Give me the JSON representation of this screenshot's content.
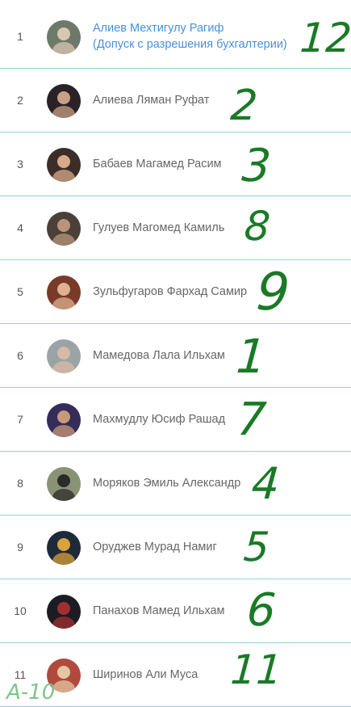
{
  "rows": [
    {
      "num": "1",
      "name": "Алиев Мехтигулу Рагиф",
      "note": "(Допуск с разрешения бухгалтерии)",
      "mark": "12",
      "colors": [
        "#6d7a6a",
        "#d9c7b0"
      ]
    },
    {
      "num": "2",
      "name": "Алиева Ляман Руфат",
      "note": "",
      "mark": "2",
      "colors": [
        "#2a2226",
        "#c8a086"
      ]
    },
    {
      "num": "3",
      "name": "Бабаев Магамед Расим",
      "note": "",
      "mark": "3",
      "colors": [
        "#3b2e29",
        "#d8a98a"
      ]
    },
    {
      "num": "4",
      "name": "Гулуев Магомед Камиль",
      "note": "",
      "mark": "8",
      "colors": [
        "#4a4038",
        "#b8957a"
      ]
    },
    {
      "num": "5",
      "name": "Зульфугаров Фархад Самир",
      "note": "",
      "mark": "9",
      "colors": [
        "#7a3a2a",
        "#e0b090"
      ]
    },
    {
      "num": "6",
      "name": "Мамедова Лала Ильхам",
      "note": "",
      "mark": "1",
      "colors": [
        "#9aa3a6",
        "#d8b9a6"
      ]
    },
    {
      "num": "7",
      "name": "Махмудлу Юсиф Рашад",
      "note": "",
      "mark": "7",
      "colors": [
        "#352c5a",
        "#c89a7a"
      ]
    },
    {
      "num": "8",
      "name": "Моряков Эмиль Александр",
      "note": "",
      "mark": "4",
      "colors": [
        "#8a9276",
        "#2b2b2b"
      ]
    },
    {
      "num": "9",
      "name": "Оруджев Мурад Намиг",
      "note": "",
      "mark": "5",
      "colors": [
        "#1e2a3a",
        "#d9a23a"
      ]
    },
    {
      "num": "10",
      "name": "Панахов Мамед Ильхам",
      "note": "",
      "mark": "6",
      "colors": [
        "#1c1c24",
        "#a03030"
      ]
    },
    {
      "num": "11",
      "name": "Ширинов Али Муса",
      "note": "",
      "mark": "11",
      "colors": [
        "#b14a3e",
        "#e6c7a4"
      ]
    }
  ],
  "corner_note": "A-10"
}
